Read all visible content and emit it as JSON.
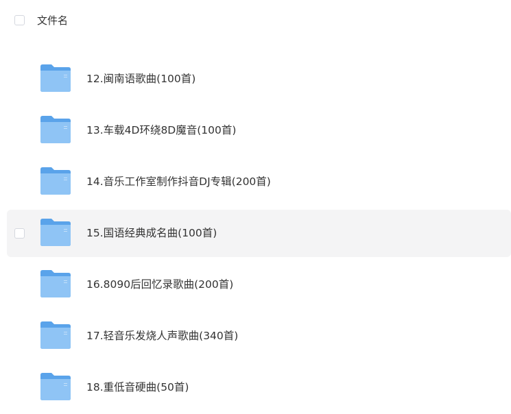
{
  "header": {
    "column_label": "文件名"
  },
  "files": [
    {
      "name": "12.闽南语歌曲(100首)",
      "selected": false
    },
    {
      "name": "13.车载4D环绕8D魔音(100首)",
      "selected": false
    },
    {
      "name": "14.音乐工作室制作抖音DJ专辑(200首)",
      "selected": false
    },
    {
      "name": "15.国语经典成名曲(100首)",
      "selected": false,
      "hovered": true
    },
    {
      "name": "16.8090后回忆录歌曲(200首)",
      "selected": false
    },
    {
      "name": "17.轻音乐发烧人声歌曲(340首)",
      "selected": false
    },
    {
      "name": "18.重低音硬曲(50首)",
      "selected": false
    }
  ],
  "colors": {
    "folder_back": "#5aa3ea",
    "folder_front": "#8fc4f5",
    "hover_bg": "#f4f4f5",
    "text": "#333333",
    "checkbox_border": "#d4d7de"
  }
}
